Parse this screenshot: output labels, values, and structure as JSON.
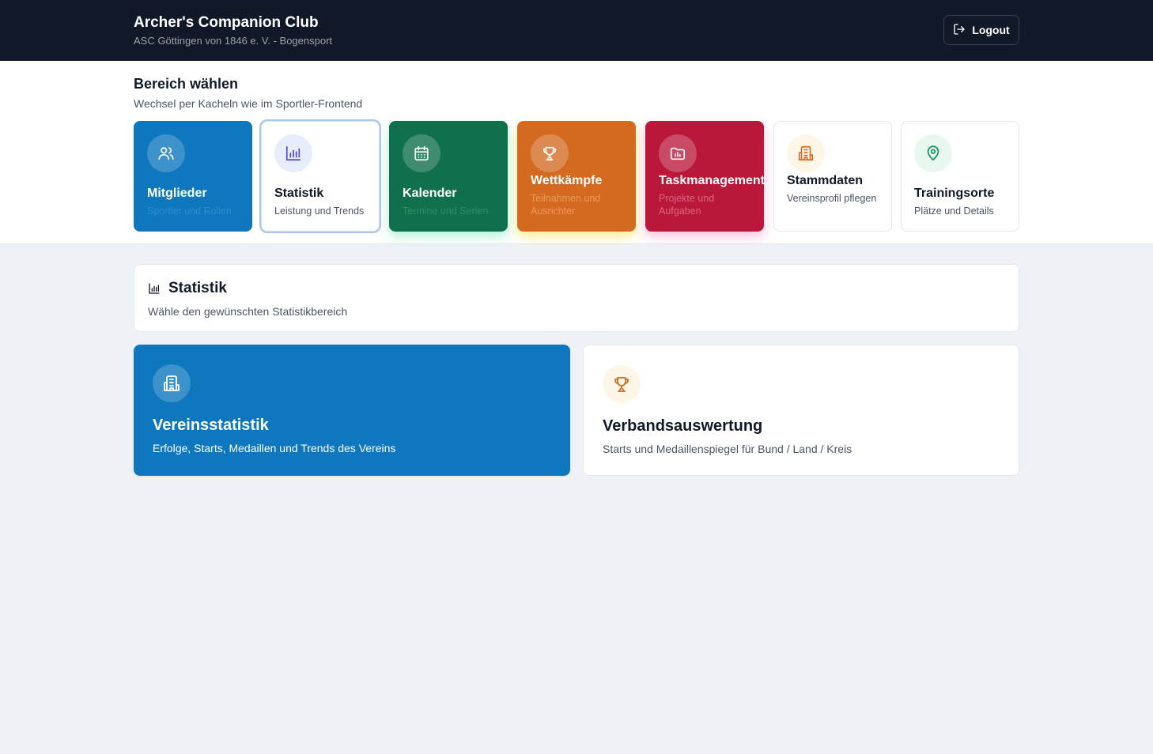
{
  "header": {
    "title": "Archer's Companion Club",
    "subtitle": "ASC Göttingen von 1846 e. V. - Bogensport",
    "logout_label": "Logout"
  },
  "selector": {
    "title": "Bereich wählen",
    "subtitle": "Wechsel per Kacheln wie im Sportler-Frontend",
    "tiles": [
      {
        "title": "Mitglieder",
        "subtitle": "Sportler und Rollen",
        "icon": "users-icon",
        "color": "#0e77be"
      },
      {
        "title": "Statistik",
        "subtitle": "Leistung und Trends",
        "icon": "bar-chart-icon",
        "color": "#ffffff",
        "active": true
      },
      {
        "title": "Kalender",
        "subtitle": "Termine und Serien",
        "icon": "calendar-icon",
        "color": "#10704d"
      },
      {
        "title": "Wettkämpfe",
        "subtitle": "Teilnahmen und Ausrichter",
        "icon": "trophy-icon",
        "color": "#d46a20"
      },
      {
        "title": "Taskmanagement",
        "subtitle": "Projekte und Aufgaben",
        "icon": "folder-icon",
        "color": "#b9183a"
      },
      {
        "title": "Stammdaten",
        "subtitle": "Vereinsprofil pflegen",
        "icon": "building-icon",
        "color": "#ffffff"
      },
      {
        "title": "Trainingsorte",
        "subtitle": "Plätze und Details",
        "icon": "map-pin-icon",
        "color": "#ffffff"
      }
    ]
  },
  "panel": {
    "title": "Statistik",
    "subtitle": "Wähle den gewünschten Statistikbereich"
  },
  "cards": [
    {
      "title": "Vereinsstatistik",
      "subtitle": "Erfolge, Starts, Medaillen und Trends des Vereins",
      "icon": "building-icon",
      "color": "#0e77be"
    },
    {
      "title": "Verbandsauswertung",
      "subtitle": "Starts und Medaillenspiegel für Bund / Land / Kreis",
      "icon": "trophy-icon",
      "color": "#ffffff"
    }
  ]
}
